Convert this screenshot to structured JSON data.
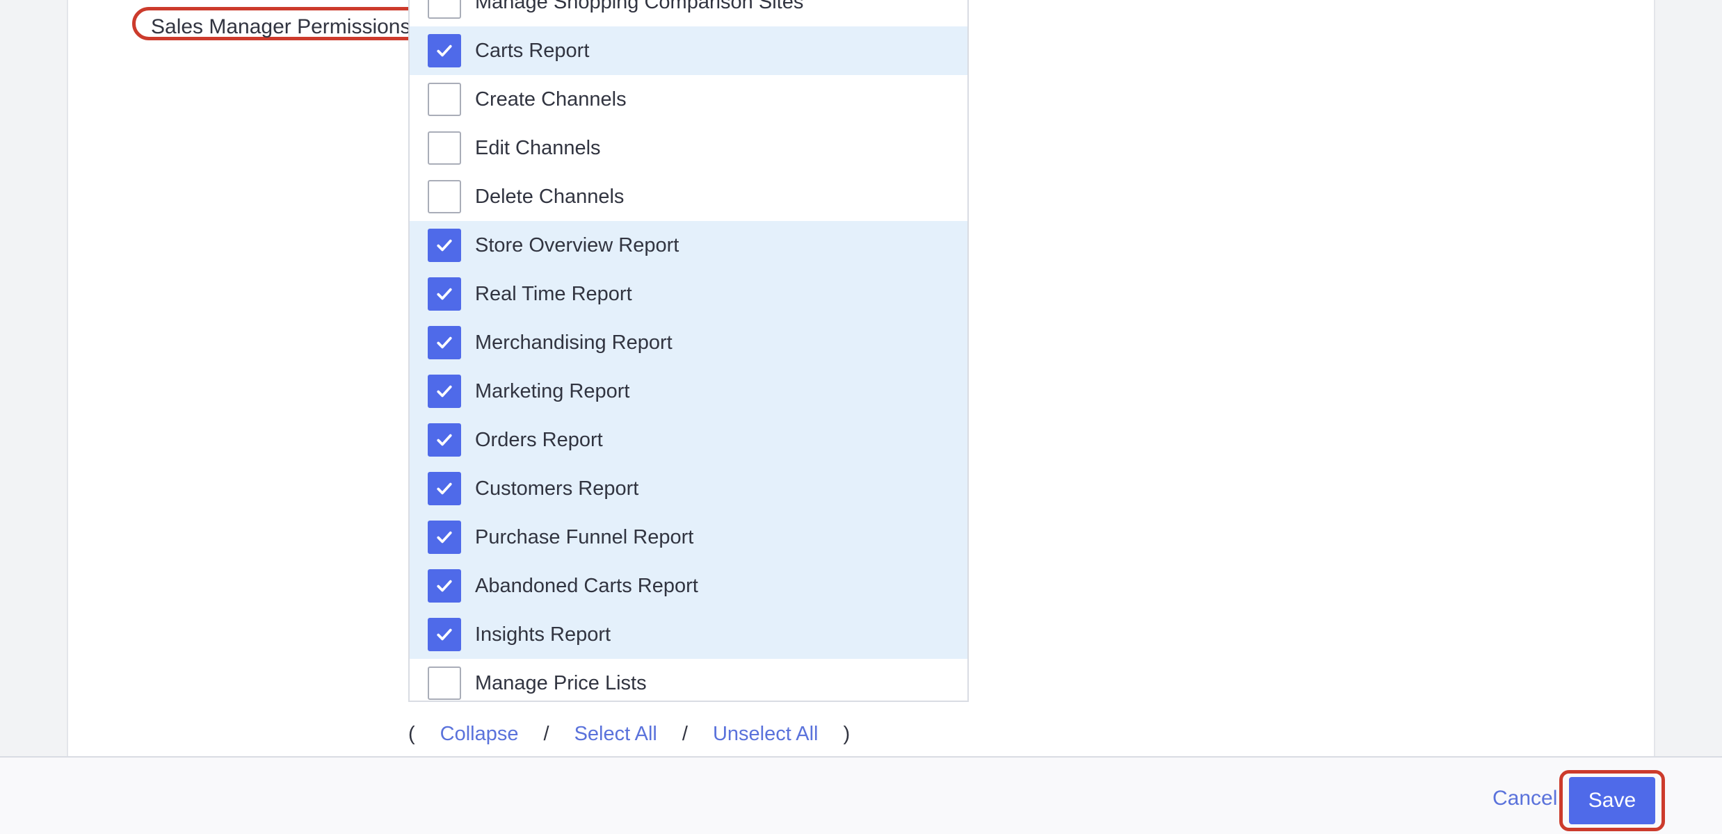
{
  "group": {
    "label": "Sales Manager Permissions"
  },
  "permissions": [
    {
      "label": "Manage Shopping Comparison Sites",
      "checked": false
    },
    {
      "label": "Carts Report",
      "checked": true
    },
    {
      "label": "Create Channels",
      "checked": false
    },
    {
      "label": "Edit Channels",
      "checked": false
    },
    {
      "label": "Delete Channels",
      "checked": false
    },
    {
      "label": "Store Overview Report",
      "checked": true
    },
    {
      "label": "Real Time Report",
      "checked": true
    },
    {
      "label": "Merchandising Report",
      "checked": true
    },
    {
      "label": "Marketing Report",
      "checked": true
    },
    {
      "label": "Orders Report",
      "checked": true
    },
    {
      "label": "Customers Report",
      "checked": true
    },
    {
      "label": "Purchase Funnel Report",
      "checked": true
    },
    {
      "label": "Abandoned Carts Report",
      "checked": true
    },
    {
      "label": "Insights Report",
      "checked": true
    },
    {
      "label": "Manage Price Lists",
      "checked": false
    }
  ],
  "bulk_actions": {
    "open_paren": "(",
    "collapse": "Collapse",
    "separator": "/",
    "select_all": "Select All",
    "unselect_all": "Unselect All",
    "close_paren": ")"
  },
  "footer": {
    "cancel_label": "Cancel",
    "save_label": "Save"
  },
  "colors": {
    "accent": "#4f6ae9",
    "highlight_ring": "#cc3b2c",
    "checked_row_bg": "#e4f0fb",
    "link": "#5a72db"
  }
}
